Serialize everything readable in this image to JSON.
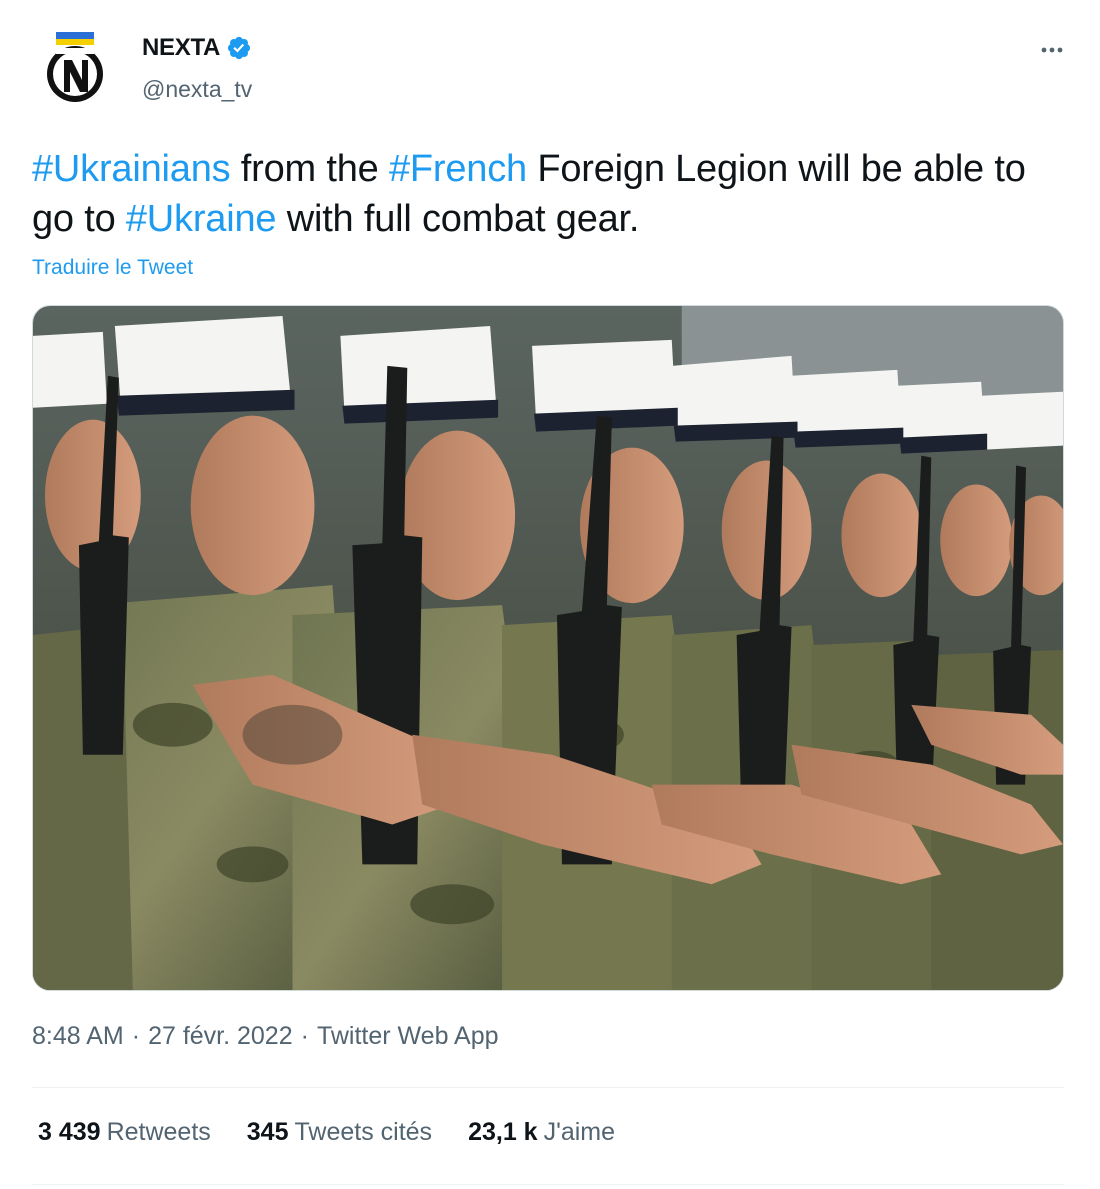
{
  "author": {
    "display_name": "NEXTA",
    "handle": "@nexta_tv",
    "verified": true,
    "avatar_icon": "nexta-logo-icon",
    "verified_icon": "verified-badge-icon",
    "more_icon": "more-options-icon"
  },
  "tweet": {
    "segments": [
      {
        "text": "#Ukrainians",
        "type": "hashtag"
      },
      {
        "text": " from the ",
        "type": "text"
      },
      {
        "text": "#French",
        "type": "hashtag"
      },
      {
        "text": " Foreign Legion will be able to go to ",
        "type": "text"
      },
      {
        "text": "#Ukraine",
        "type": "hashtag"
      },
      {
        "text": " with full combat gear.",
        "type": "text"
      }
    ],
    "translate_label": "Traduire le Tweet"
  },
  "meta": {
    "time": "8:48 AM",
    "separator": "·",
    "date": "27 févr. 2022",
    "source": "Twitter Web App"
  },
  "stats": [
    {
      "count": "3 439",
      "label": "Retweets"
    },
    {
      "count": "345",
      "label": "Tweets cités"
    },
    {
      "count": "23,1 k",
      "label": "J'aime"
    }
  ],
  "colors": {
    "link": "#1d9bf0",
    "secondary_text": "#536471",
    "primary_text": "#0f1419",
    "divider": "#eff3f4"
  }
}
